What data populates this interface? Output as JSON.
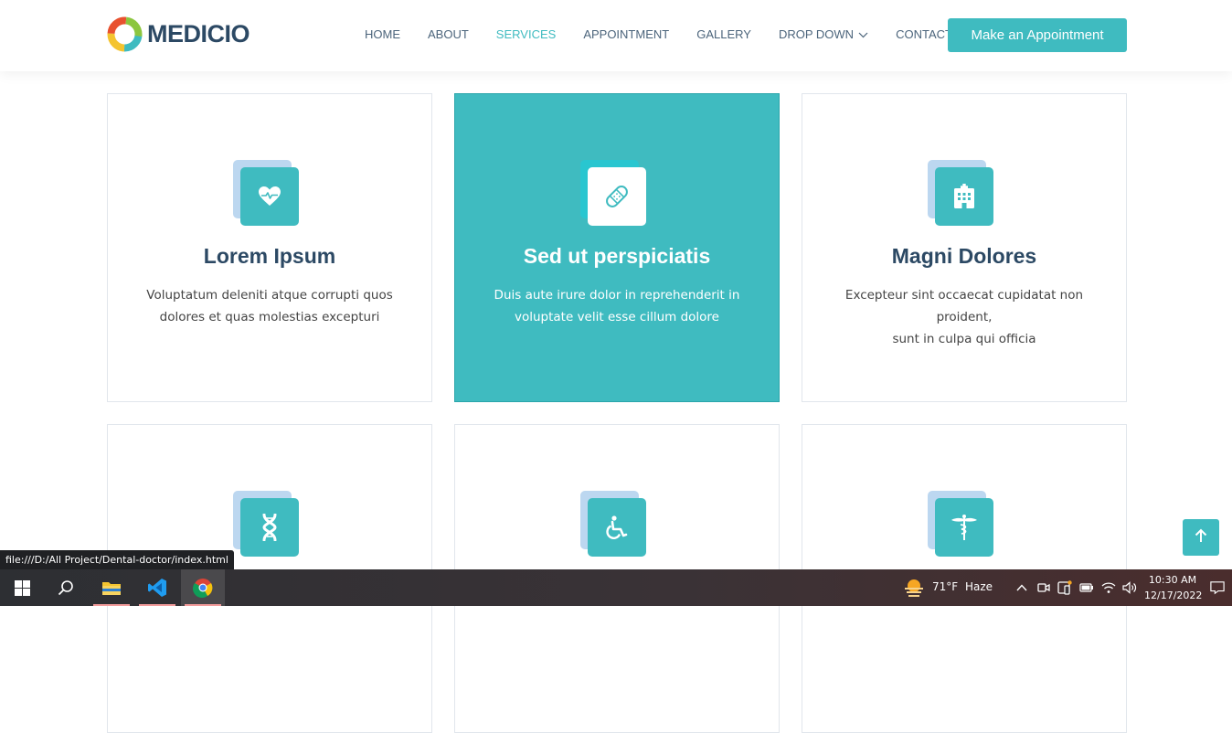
{
  "brand": {
    "name": "MEDICIO",
    "accent": "#3fbbc0",
    "text_color": "#2c4964"
  },
  "nav": {
    "items": [
      {
        "label": "HOME",
        "active": false
      },
      {
        "label": "ABOUT",
        "active": false
      },
      {
        "label": "SERVICES",
        "active": true
      },
      {
        "label": "APPOINTMENT",
        "active": false
      },
      {
        "label": "GALLERY",
        "active": false
      },
      {
        "label": "DROP DOWN",
        "active": false,
        "icon": "chevron-down-icon"
      },
      {
        "label": "CONTACT",
        "active": false
      }
    ],
    "cta_label": "Make an Appointment"
  },
  "services": [
    {
      "icon": "heart-pulse-icon",
      "title": "Lorem Ipsum",
      "line1": "Voluptatum deleniti atque corrupti quos",
      "line2": "dolores et quas molestias excepturi",
      "featured": false
    },
    {
      "icon": "bandage-icon",
      "title": "Sed ut perspiciatis",
      "line1": "Duis aute irure dolor in reprehenderit in",
      "line2": "voluptate velit esse cillum dolore",
      "featured": true
    },
    {
      "icon": "hospital-icon",
      "title": "Magni Dolores",
      "line1": "Excepteur sint occaecat cupidatat non proident,",
      "line2": "sunt in culpa qui officia",
      "featured": false
    },
    {
      "icon": "dna-icon",
      "featured": false
    },
    {
      "icon": "wheelchair-icon",
      "featured": false
    },
    {
      "icon": "caduceus-icon",
      "featured": false
    }
  ],
  "back_to_top_icon": "arrow-up-icon",
  "status_bar": {
    "url": "file:///D:/All Project/Dental-doctor/index.html"
  },
  "taskbar": {
    "apps": [
      "windows-start-icon",
      "search-icon",
      "file-explorer-icon",
      "vscode-icon",
      "chrome-icon"
    ],
    "weather": {
      "temp": "71°F",
      "condition": "Haze",
      "icon": "haze-sun-icon"
    },
    "tray_icons": [
      "chevron-up-icon",
      "meet-now-icon",
      "phone-link-icon",
      "battery-icon",
      "wifi-icon",
      "volume-icon"
    ],
    "time": "10:30 AM",
    "date": "12/17/2022",
    "notification_icon": "notification-icon"
  }
}
